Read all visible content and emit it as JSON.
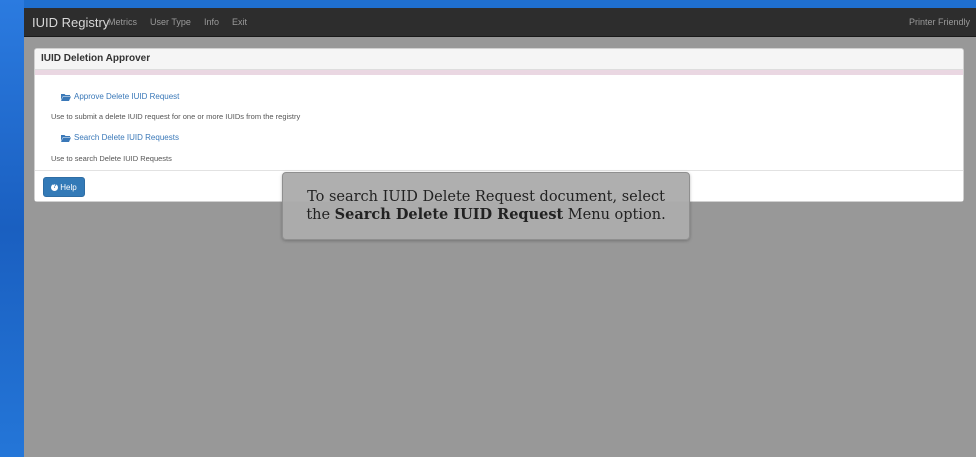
{
  "navbar": {
    "brand": "IUID Registry",
    "links": [
      "Metrics",
      "User Type",
      "Info",
      "Exit"
    ],
    "printer": "Printer Friendly"
  },
  "panel": {
    "title": "IUID Deletion Approver",
    "items": [
      {
        "label": "Approve Delete IUID Request",
        "desc": "Use to submit a delete IUID request for one or more IUIDs from the registry"
      },
      {
        "label": "Search Delete IUID Requests",
        "desc": "Use to search Delete IUID Requests"
      }
    ],
    "help_label": "Help"
  },
  "tooltip": {
    "line1": "To search IUID Delete Request document, select",
    "line2_pre": "the ",
    "line2_bold": "Search Delete IUID Request",
    "line2_post": " Menu option."
  },
  "colors": {
    "navbar": "#2d2d2d",
    "link": "#3a78b8",
    "help_button": "#337ab7",
    "overlay": "#989898"
  }
}
